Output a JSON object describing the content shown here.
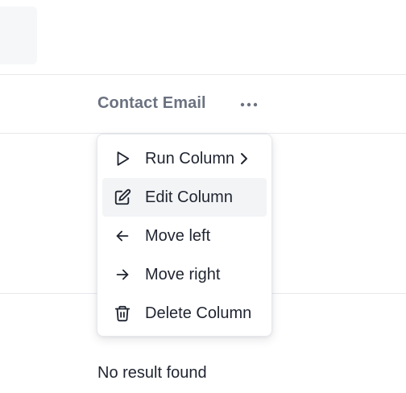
{
  "header": {
    "column_title": "Contact Email"
  },
  "column_menu": {
    "items": [
      {
        "label": "Run Column",
        "icon": "play-icon",
        "has_submenu": true
      },
      {
        "label": "Edit Column",
        "icon": "edit-icon",
        "active": true
      },
      {
        "label": "Move left",
        "icon": "arrow-left-icon"
      },
      {
        "label": "Move right",
        "icon": "arrow-right-icon"
      },
      {
        "label": "Delete Column",
        "icon": "trash-icon"
      }
    ]
  },
  "table": {
    "empty_message": "No result found"
  }
}
